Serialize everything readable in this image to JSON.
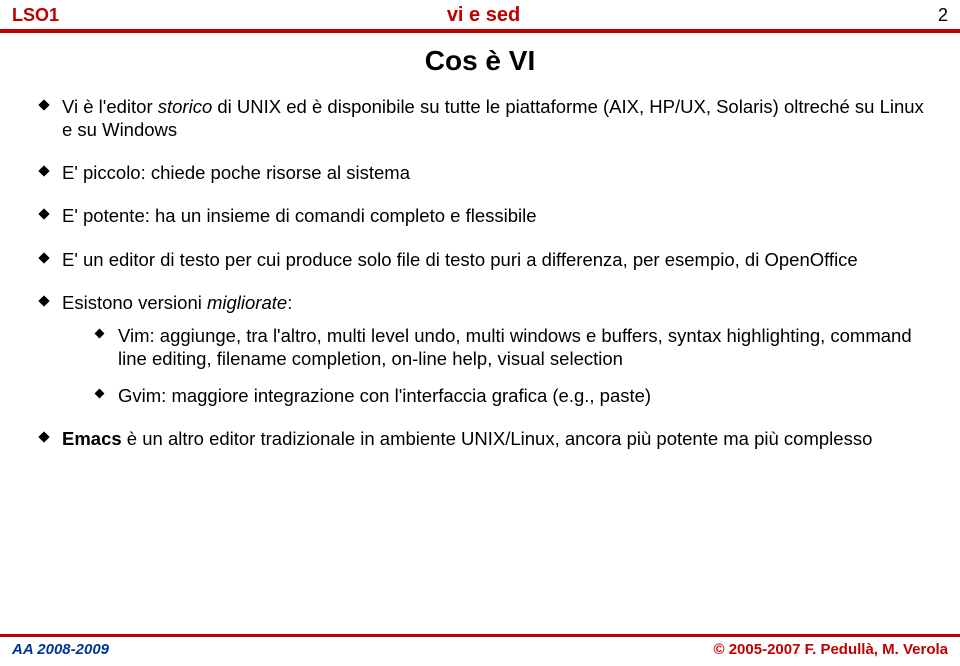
{
  "header": {
    "left": "LSO1",
    "center": "vi e sed",
    "page_number": "2"
  },
  "title": "Cos è VI",
  "bullets": [
    {
      "prefix": "Vi è l'editor ",
      "em": "storico",
      "suffix": " di UNIX ed è disponibile su tutte le piattaforme (AIX, HP/UX, Solaris) oltreché su Linux e su Windows"
    },
    {
      "text": "E' piccolo: chiede poche risorse al sistema"
    },
    {
      "text": "E' potente: ha un insieme di comandi completo e flessibile"
    },
    {
      "text": "E' un editor di testo per cui produce solo file di testo puri a differenza, per esempio, di OpenOffice"
    },
    {
      "prefix": "Esistono versioni ",
      "em": "migliorate",
      "suffix": ":",
      "sub": [
        {
          "text": "Vim: aggiunge, tra l'altro, multi level undo, multi windows e buffers, syntax highlighting, command line editing, filename completion, on-line help, visual selection"
        },
        {
          "text": "Gvim: maggiore integrazione con l'interfaccia grafica (e.g., paste)"
        }
      ]
    },
    {
      "bold": "Emacs",
      "suffix": " è un altro editor tradizionale in ambiente UNIX/Linux, ancora più potente ma più complesso"
    }
  ],
  "footer": {
    "left": "AA 2008-2009",
    "right": "© 2005-2007 F. Pedullà, M. Verola"
  }
}
